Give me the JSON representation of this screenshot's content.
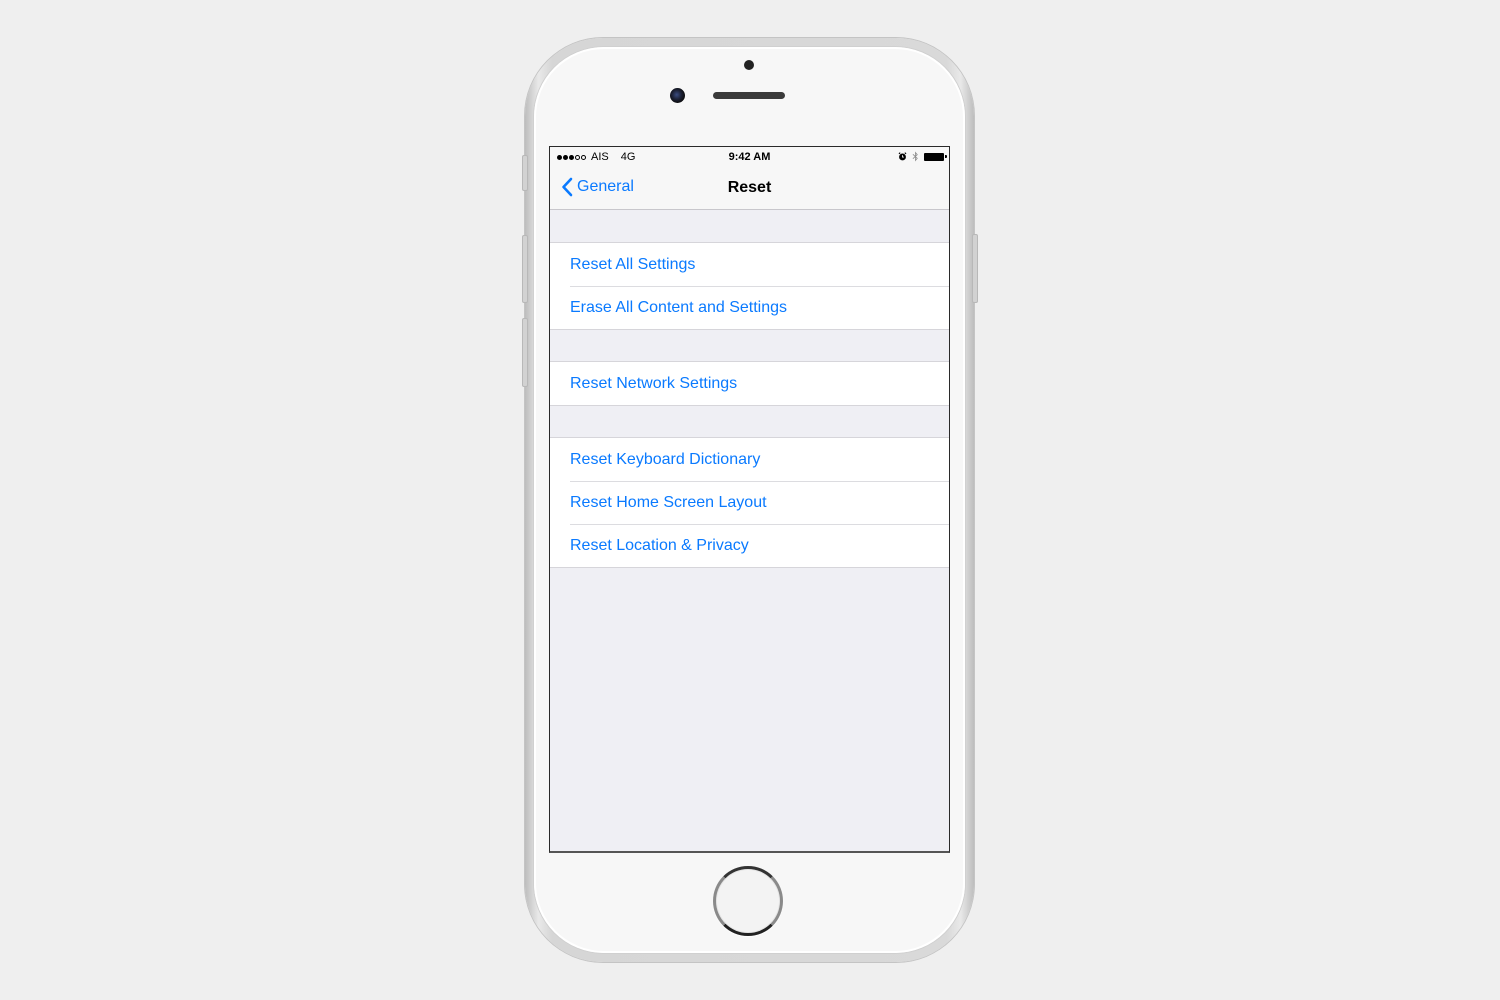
{
  "status_bar": {
    "signal_bars_filled": 3,
    "signal_bars_total": 5,
    "carrier": "AIS",
    "network": "4G",
    "time": "9:42 AM",
    "icons": [
      "alarm-icon",
      "bluetooth-icon",
      "battery-icon"
    ],
    "battery_level": 1.0
  },
  "nav": {
    "back_label": "General",
    "title": "Reset"
  },
  "groups": [
    {
      "items": [
        {
          "label": "Reset All Settings"
        },
        {
          "label": "Erase All Content and Settings"
        }
      ]
    },
    {
      "items": [
        {
          "label": "Reset Network Settings"
        }
      ]
    },
    {
      "items": [
        {
          "label": "Reset Keyboard Dictionary"
        },
        {
          "label": "Reset Home Screen Layout"
        },
        {
          "label": "Reset Location & Privacy"
        }
      ]
    }
  ],
  "colors": {
    "accent": "#0a7aff",
    "grouped_background": "#efeff4",
    "bar_background": "#f7f7f7",
    "page_background": "#efefef"
  }
}
